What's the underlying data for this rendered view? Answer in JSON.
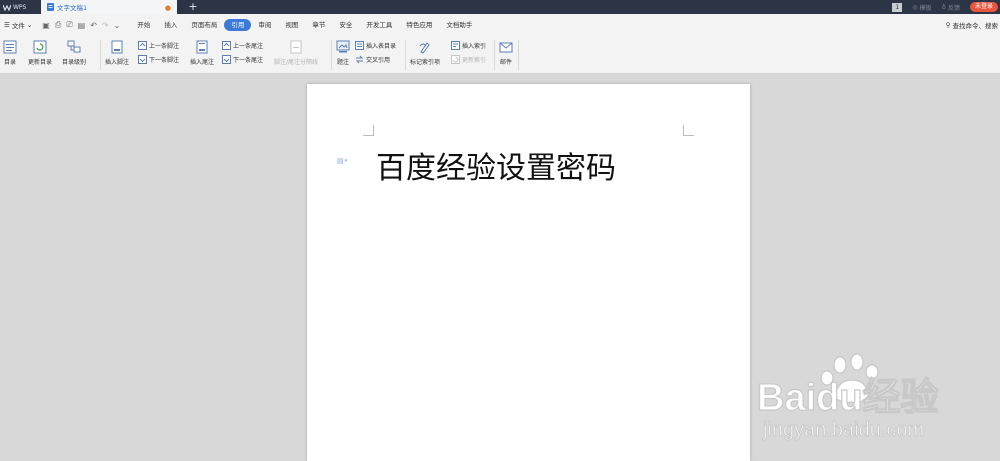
{
  "titlebar": {
    "app_name": "WPS",
    "doc_tab": "文字文稿1",
    "new_tab": "+",
    "badge": "1",
    "skin_label": "模板",
    "feedback_label": "反馈",
    "login": "未登录"
  },
  "menubar": {
    "file": "文件",
    "tabs": [
      {
        "label": "开始"
      },
      {
        "label": "插入"
      },
      {
        "label": "页面布局"
      },
      {
        "label": "引用"
      },
      {
        "label": "审阅"
      },
      {
        "label": "视图"
      },
      {
        "label": "章节"
      },
      {
        "label": "安全"
      },
      {
        "label": "开发工具"
      },
      {
        "label": "特色应用"
      },
      {
        "label": "文档助手"
      }
    ],
    "active_tab": "引用",
    "search": "查找命令、搜索"
  },
  "ribbon": {
    "toc": "目录",
    "update_toc": "更新目录",
    "toc_level": "目录级别",
    "insert_footnote": "插入脚注",
    "prev_footnote": "上一条脚注",
    "next_footnote": "下一条脚注",
    "insert_endnote": "插入尾注",
    "prev_endnote": "上一条尾注",
    "next_endnote": "下一条尾注",
    "footnote_separator": "脚注/尾注分隔线",
    "caption": "题注",
    "insert_table_of_figures": "插入表目录",
    "cross_reference": "交叉引用",
    "mark_entry": "标记索引项",
    "insert_index": "插入索引",
    "update_index": "更新索引",
    "mail": "邮件"
  },
  "document": {
    "text": "百度经验设置密码"
  },
  "watermark": {
    "brand": "Baidu经验",
    "url": "jingyan.baidu.com"
  },
  "colors": {
    "accent": "#3c7ad8",
    "titlebar": "#2b3545",
    "login": "#e8553d"
  }
}
